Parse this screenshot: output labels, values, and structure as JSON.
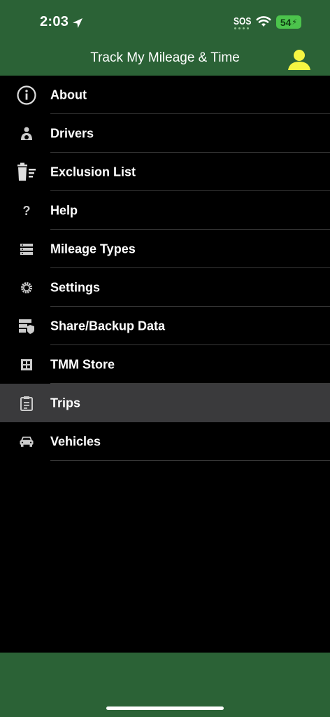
{
  "status": {
    "time": "2:03",
    "sos": "SOS",
    "battery": "54"
  },
  "header": {
    "title": "Track My Mileage & Time"
  },
  "menu": {
    "items": [
      {
        "label": "About",
        "icon": "info-icon"
      },
      {
        "label": "Drivers",
        "icon": "driver-icon"
      },
      {
        "label": "Exclusion List",
        "icon": "exclusion-list-icon"
      },
      {
        "label": "Help",
        "icon": "help-icon"
      },
      {
        "label": "Mileage Types",
        "icon": "mileage-types-icon"
      },
      {
        "label": "Settings",
        "icon": "settings-icon"
      },
      {
        "label": "Share/Backup Data",
        "icon": "share-backup-icon"
      },
      {
        "label": "TMM Store",
        "icon": "store-icon"
      },
      {
        "label": "Trips",
        "icon": "trips-icon",
        "selected": true
      },
      {
        "label": "Vehicles",
        "icon": "vehicle-icon"
      }
    ]
  },
  "colors": {
    "header_green": "#2b6236",
    "profile_yellow": "#f5f542",
    "selected_row": "#3a3a3c"
  }
}
